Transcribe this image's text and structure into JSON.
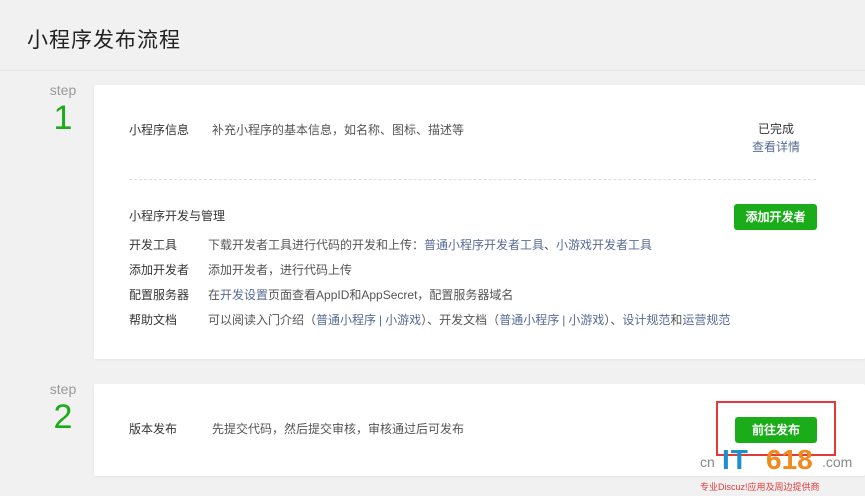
{
  "page": {
    "title": "小程序发布流程"
  },
  "step1": {
    "label": "step",
    "number": "1",
    "info": {
      "title": "小程序信息",
      "desc": "补充小程序的基本信息，如名称、图标、描述等",
      "status": "已完成",
      "link": "查看详情"
    },
    "dev": {
      "title": "小程序开发与管理",
      "button": "添加开发者",
      "rows": [
        {
          "label": "开发工具",
          "text1": "下载开发者工具进行代码的开发和上传：",
          "link1": "普通小程序开发者工具",
          "text2": "、",
          "link2": "小游戏开发者工具"
        },
        {
          "label": "添加开发者",
          "text1": "添加开发者，进行代码上传"
        },
        {
          "label": "配置服务器",
          "text1": "在",
          "link1": "开发设置",
          "text2": "页面查看AppID和AppSecret，配置服务器域名"
        },
        {
          "label": "帮助文档",
          "text1": "可以阅读入门介绍（",
          "link1": "普通小程序",
          "sep1": "|",
          "link2": "小游戏",
          "text2": "）、开发文档（",
          "link3": "普通小程序",
          "sep2": "|",
          "link4": "小游戏",
          "text3": "）、",
          "link5": "设计规范",
          "text4": "和",
          "link6": "运营规范"
        }
      ]
    }
  },
  "step2": {
    "label": "step",
    "number": "2",
    "title": "版本发布",
    "desc": "先提交代码，然后提交审核，审核通过后可发布",
    "button": "前往发布"
  },
  "watermark": {
    "cn": "cn",
    "it": "IT",
    "num": "618",
    "com": ".com",
    "slogan": "专业Discuz!应用及周边提供商"
  },
  "colors": {
    "accent": "#1aad19",
    "link": "#576b95",
    "highlight": "#e23a3a"
  }
}
